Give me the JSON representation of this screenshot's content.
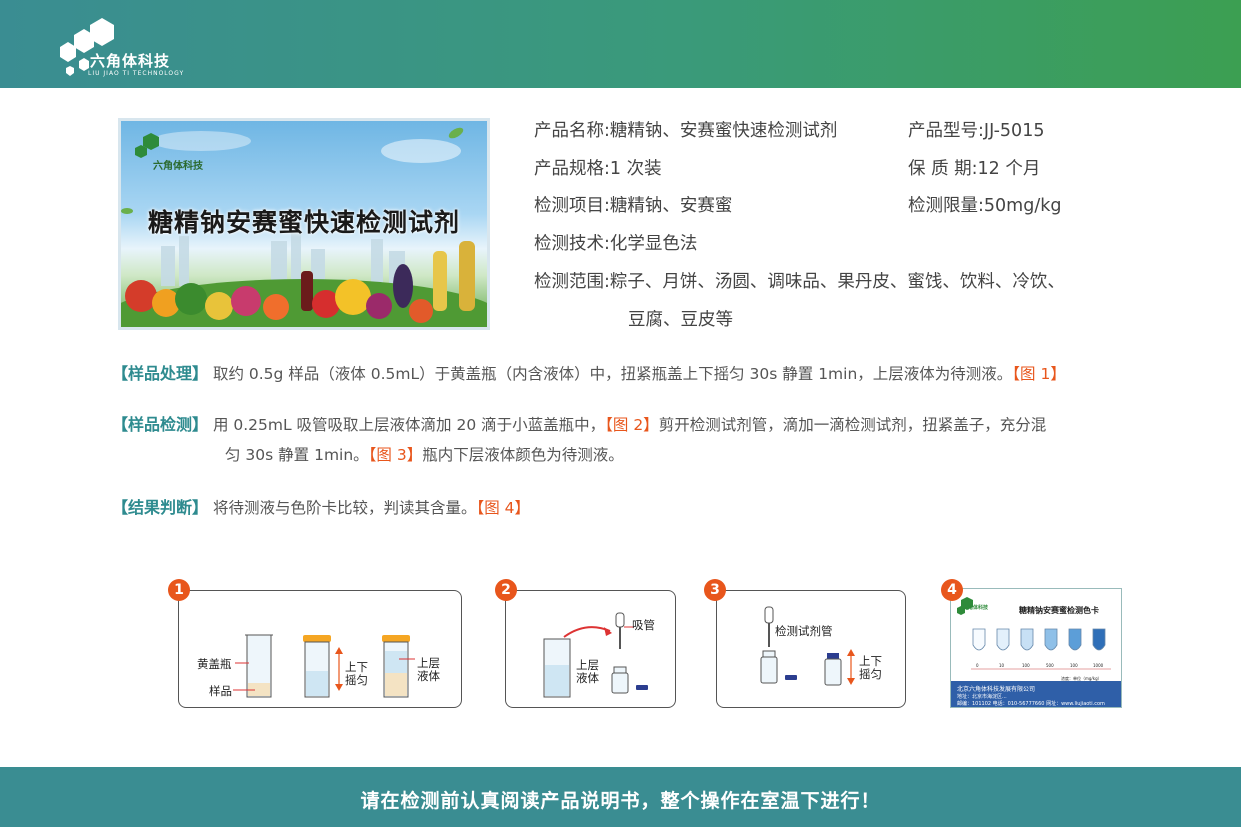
{
  "brand": {
    "name": "六角体科技",
    "english": "LIU JIAO TI TECHNOLOGY"
  },
  "product_image": {
    "title": "糖精钠安赛蜜快速检测试剂",
    "logo_name": "六角体科技"
  },
  "info": {
    "name_label": "产品名称:",
    "name_value": "糖精钠、安赛蜜快速检测试剂",
    "model_label": "产品型号:",
    "model_value": "JJ-5015",
    "spec_label": "产品规格:",
    "spec_value": "1 次装",
    "shelf_label": "保 质 期:",
    "shelf_value": "12 个月",
    "item_label": "检测项目:",
    "item_value": "糖精钠、安赛蜜",
    "limit_label": "检测限量:",
    "limit_value": "50mg/kg",
    "tech_label": "检测技术:",
    "tech_value": "化学显色法",
    "range_label": "检测范围:",
    "range_value_line1": "粽子、月饼、汤圆、调味品、果丹皮、蜜饯、饮料、冷饮、",
    "range_value_line2": "豆腐、豆皮等"
  },
  "sections": {
    "processing_tag": "【样品处理】",
    "processing_text": "取约 0.5g 样品（液体 0.5mL）于黄盖瓶（内含液体）中，扭紧瓶盖上下摇匀 30s 静置 1min，上层液体为待测液。",
    "processing_ref": "【图 1】",
    "detection_tag": "【样品检测】",
    "detection_text1": "用 0.25mL 吸管吸取上层液体滴加 20 滴于小蓝盖瓶中，",
    "detection_ref1": "【图 2】",
    "detection_text2": "剪开检测试剂管，滴加一滴检测试剂，扭紧盖子，充分混",
    "detection_text3": "匀 30s 静置 1min。",
    "detection_ref2": "【图 3】",
    "detection_text4": "瓶内下层液体颜色为待测液。",
    "result_tag": "【结果判断】",
    "result_text": "将待测液与色阶卡比较，判读其含量。",
    "result_ref": "【图 4】"
  },
  "steps": {
    "s1": {
      "num": "1",
      "bottle_label": "黄盖瓶",
      "sample_label": "样品",
      "shake_label": "上下\n摇匀",
      "upper_label": "上层\n液体"
    },
    "s2": {
      "num": "2",
      "pipette_label": "吸管",
      "upper_label": "上层\n液体"
    },
    "s3": {
      "num": "3",
      "tube_label": "检测试剂管",
      "shake_label": "上下\n摇匀"
    },
    "s4": {
      "num": "4",
      "card_title": "糖精钠安赛蜜检测色卡",
      "card_logo": "六角体科技",
      "levels": [
        "0",
        "10",
        "100",
        "500",
        "100",
        "1000"
      ],
      "unit": "浓度：单位（mg/kg）",
      "company": "北京六角体科技发展有限公司",
      "address": "地址：北京市海淀区...",
      "contact": "邮编：101102    电话：010-56777660    网址：www.liujiaoti.com"
    }
  },
  "footer": {
    "text": "请在检测前认真阅读产品说明书，整个操作在室温下进行！"
  },
  "colors": {
    "teal": "#3a8d92",
    "green": "#3c9f52",
    "accent": "#e8561c"
  }
}
